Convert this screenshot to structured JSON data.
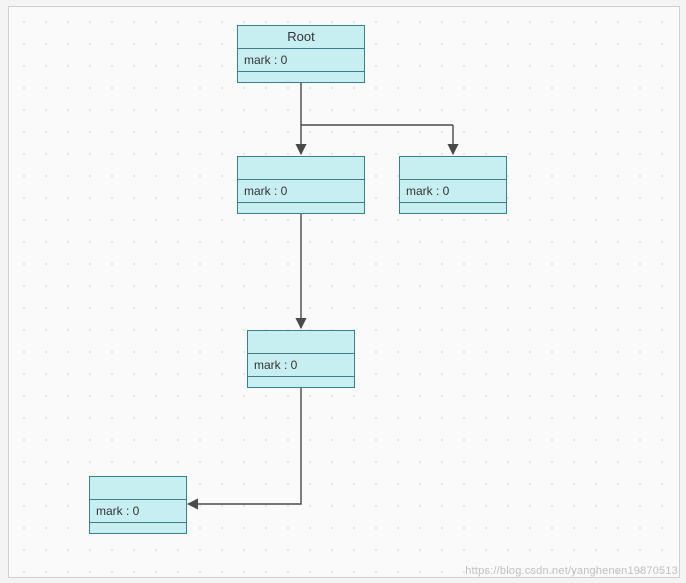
{
  "diagram": {
    "root": {
      "title": "Root",
      "mark_label": "mark : 0"
    },
    "node_a": {
      "title": "",
      "mark_label": "mark : 0"
    },
    "node_b": {
      "title": "",
      "mark_label": "mark : 0"
    },
    "node_c": {
      "title": "",
      "mark_label": "mark : 0"
    },
    "node_d": {
      "title": "",
      "mark_label": "mark : 0"
    }
  },
  "colors": {
    "node_fill": "#c7eff2",
    "node_border": "#3a7f8a",
    "edge": "#4a4a4a",
    "bg": "#fafafa"
  },
  "watermark": "https://blog.csdn.net/yanghenen19870513"
}
